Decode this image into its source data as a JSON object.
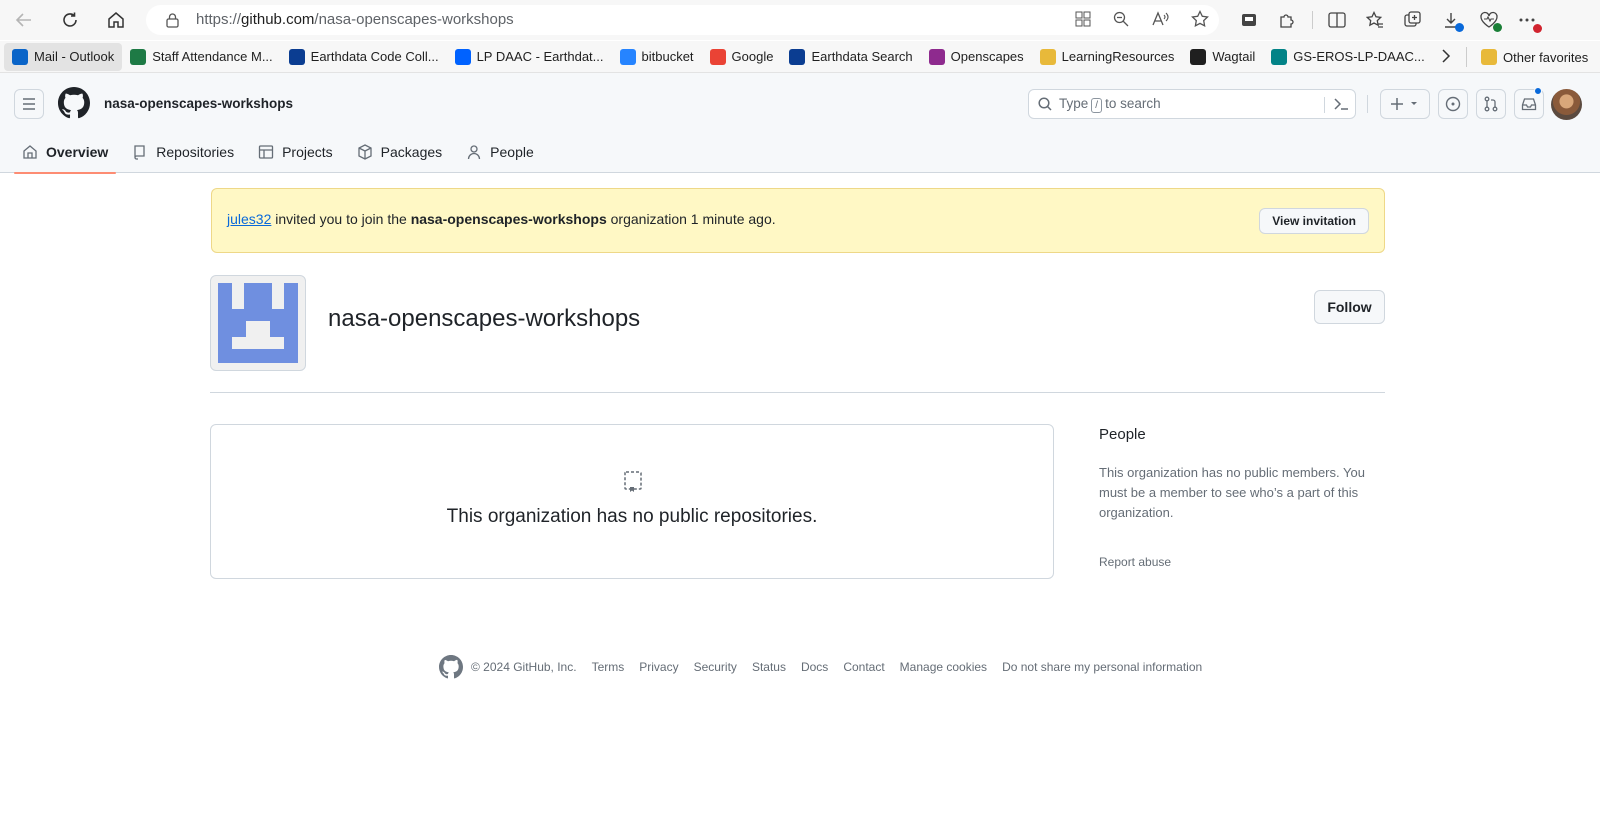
{
  "browser": {
    "url_prefix": "https://",
    "url_host": "github.com",
    "url_path": "/nasa-openscapes-workshops",
    "bookmarks": [
      {
        "label": "Mail - Outlook",
        "color": "#0a64c8"
      },
      {
        "label": "Staff Attendance M...",
        "color": "#1e7a45"
      },
      {
        "label": "Earthdata Code Coll...",
        "color": "#0b3d91"
      },
      {
        "label": "LP DAAC - Earthdat...",
        "color": "#0062ff"
      },
      {
        "label": "bitbucket",
        "color": "#2684ff"
      },
      {
        "label": "Google",
        "color": "#ea4335"
      },
      {
        "label": "Earthdata Search",
        "color": "#0b3d91"
      },
      {
        "label": "Openscapes",
        "color": "#8e2a8e"
      },
      {
        "label": "LearningResources",
        "color": "#e8b93a"
      },
      {
        "label": "Wagtail",
        "color": "#1f1f1f"
      },
      {
        "label": "GS-EROS-LP-DAAC...",
        "color": "#038387"
      }
    ],
    "other_favorites": "Other favorites"
  },
  "header": {
    "org_breadcrumb": "nasa-openscapes-workshops",
    "search_prefix": "Type",
    "search_key": "/",
    "search_suffix": "to search"
  },
  "tabs": [
    {
      "label": "Overview",
      "icon": "home-icon",
      "selected": true
    },
    {
      "label": "Repositories",
      "icon": "repo-icon",
      "selected": false
    },
    {
      "label": "Projects",
      "icon": "table-icon",
      "selected": false
    },
    {
      "label": "Packages",
      "icon": "package-icon",
      "selected": false
    },
    {
      "label": "People",
      "icon": "person-icon",
      "selected": false
    }
  ],
  "flash": {
    "user": "jules32",
    "text_1": " invited you to join the ",
    "org": "nasa-openscapes-workshops",
    "text_2": " organization 1 minute ago.",
    "button": "View invitation"
  },
  "org": {
    "name": "nasa-openscapes-workshops",
    "follow_label": "Follow",
    "avatar_color": "#6f8fe0"
  },
  "repos": {
    "empty_message": "This organization has no public repositories."
  },
  "sidebar": {
    "people_title": "People",
    "people_text": "This organization has no public members. You must be a member to see who’s a part of this organization.",
    "report_abuse": "Report abuse"
  },
  "footer": {
    "copyright": "© 2024 GitHub, Inc.",
    "links": [
      "Terms",
      "Privacy",
      "Security",
      "Status",
      "Docs",
      "Contact",
      "Manage cookies",
      "Do not share my personal information"
    ]
  },
  "colors": {
    "accent_underline": "#fd8c73",
    "flash_bg": "#fff8c5",
    "link": "#0969da"
  }
}
